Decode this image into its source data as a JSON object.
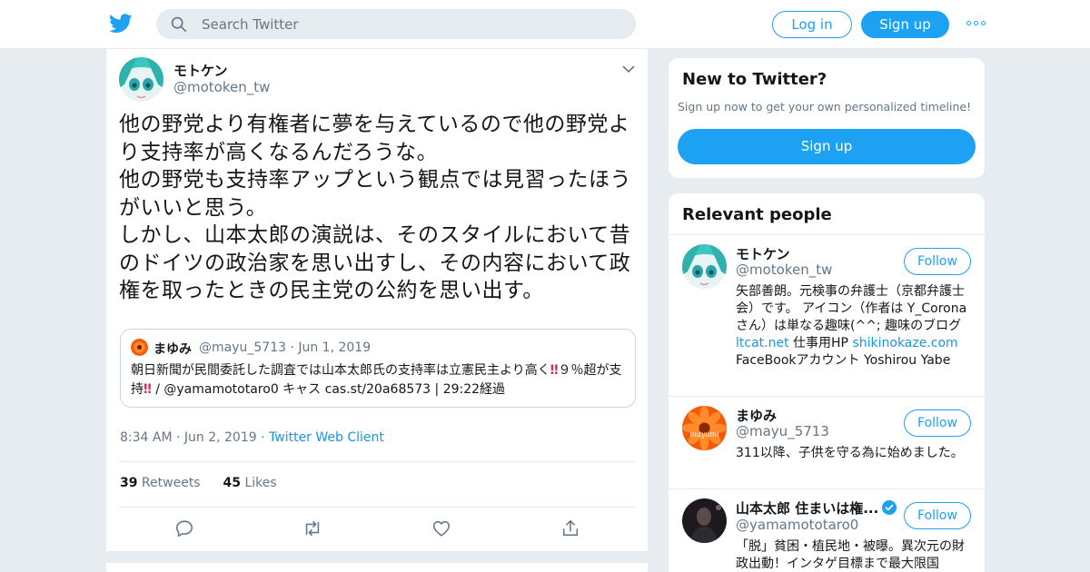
{
  "header": {
    "search_placeholder": "Search Twitter",
    "login_label": "Log in",
    "signup_label": "Sign up",
    "brand_color": "#1da1f2"
  },
  "tweet": {
    "author_name": "モトケン",
    "author_handle": "@motoken_tw",
    "text": "他の野党より有権者に夢を与えているので他の野党より支持率が高くなるんだろうな。\n他の野党も支持率アップという観点では見習ったほうがいいと思う。\nしかし、山本太郎の演説は、そのスタイルにおいて昔のドイツの政治家を思い出すし、その内容において政権を取ったときの民主党の公約を思い出す。",
    "quote": {
      "name": "まゆみ",
      "handle_date": "@mayu_5713 · Jun 1, 2019",
      "text_1": "朝日新聞が民間委託した調査では山本太郎氏の支持率は立憲民主より高く",
      "bangs_1": "‼",
      "text_2": "９％超が支持",
      "bangs_2": "‼",
      "text_3": " / @yamamototaro0 キャス cas.st/20a68573 | 29:22経過"
    },
    "timestamp": "8:34 AM · Jun 2, 2019 · ",
    "client": "Twitter Web Client",
    "retweets_count": "39",
    "retweets_label": " Retweets",
    "likes_count": "45",
    "likes_label": " Likes"
  },
  "sidebar": {
    "new_title": "New to Twitter?",
    "new_subtitle": "Sign up now to get your own personalized timeline!",
    "new_signup_label": "Sign up",
    "relevant_title": "Relevant people",
    "people": [
      {
        "name": "モトケン",
        "handle": "@motoken_tw",
        "follow_label": "Follow",
        "bio_1": "矢部善朗。元検事の弁護士（京都弁護士会）です。 アイコン（作者は Y_Coronaさん）は単なる趣味(^^; 趣味のブログ ",
        "bio_link_1": "ltcat.net",
        "bio_2": " 仕事用HP ",
        "bio_link_2": "shikinokaze.com",
        "bio_3": " FaceBookアカウント Yoshirou Yabe"
      },
      {
        "name": "まゆみ",
        "handle": "@mayu_5713",
        "follow_label": "Follow",
        "avatar_text": "mayumi",
        "bio": "311以降、子供を守る為に始めました。"
      },
      {
        "name": "山本太郎 住まいは権...",
        "handle": "@yamamototaro0",
        "follow_label": "Follow",
        "bio": "「脱」貧困・植民地・被曝。異次元の財政出動！インタゲ目標まで最大限国"
      }
    ]
  }
}
